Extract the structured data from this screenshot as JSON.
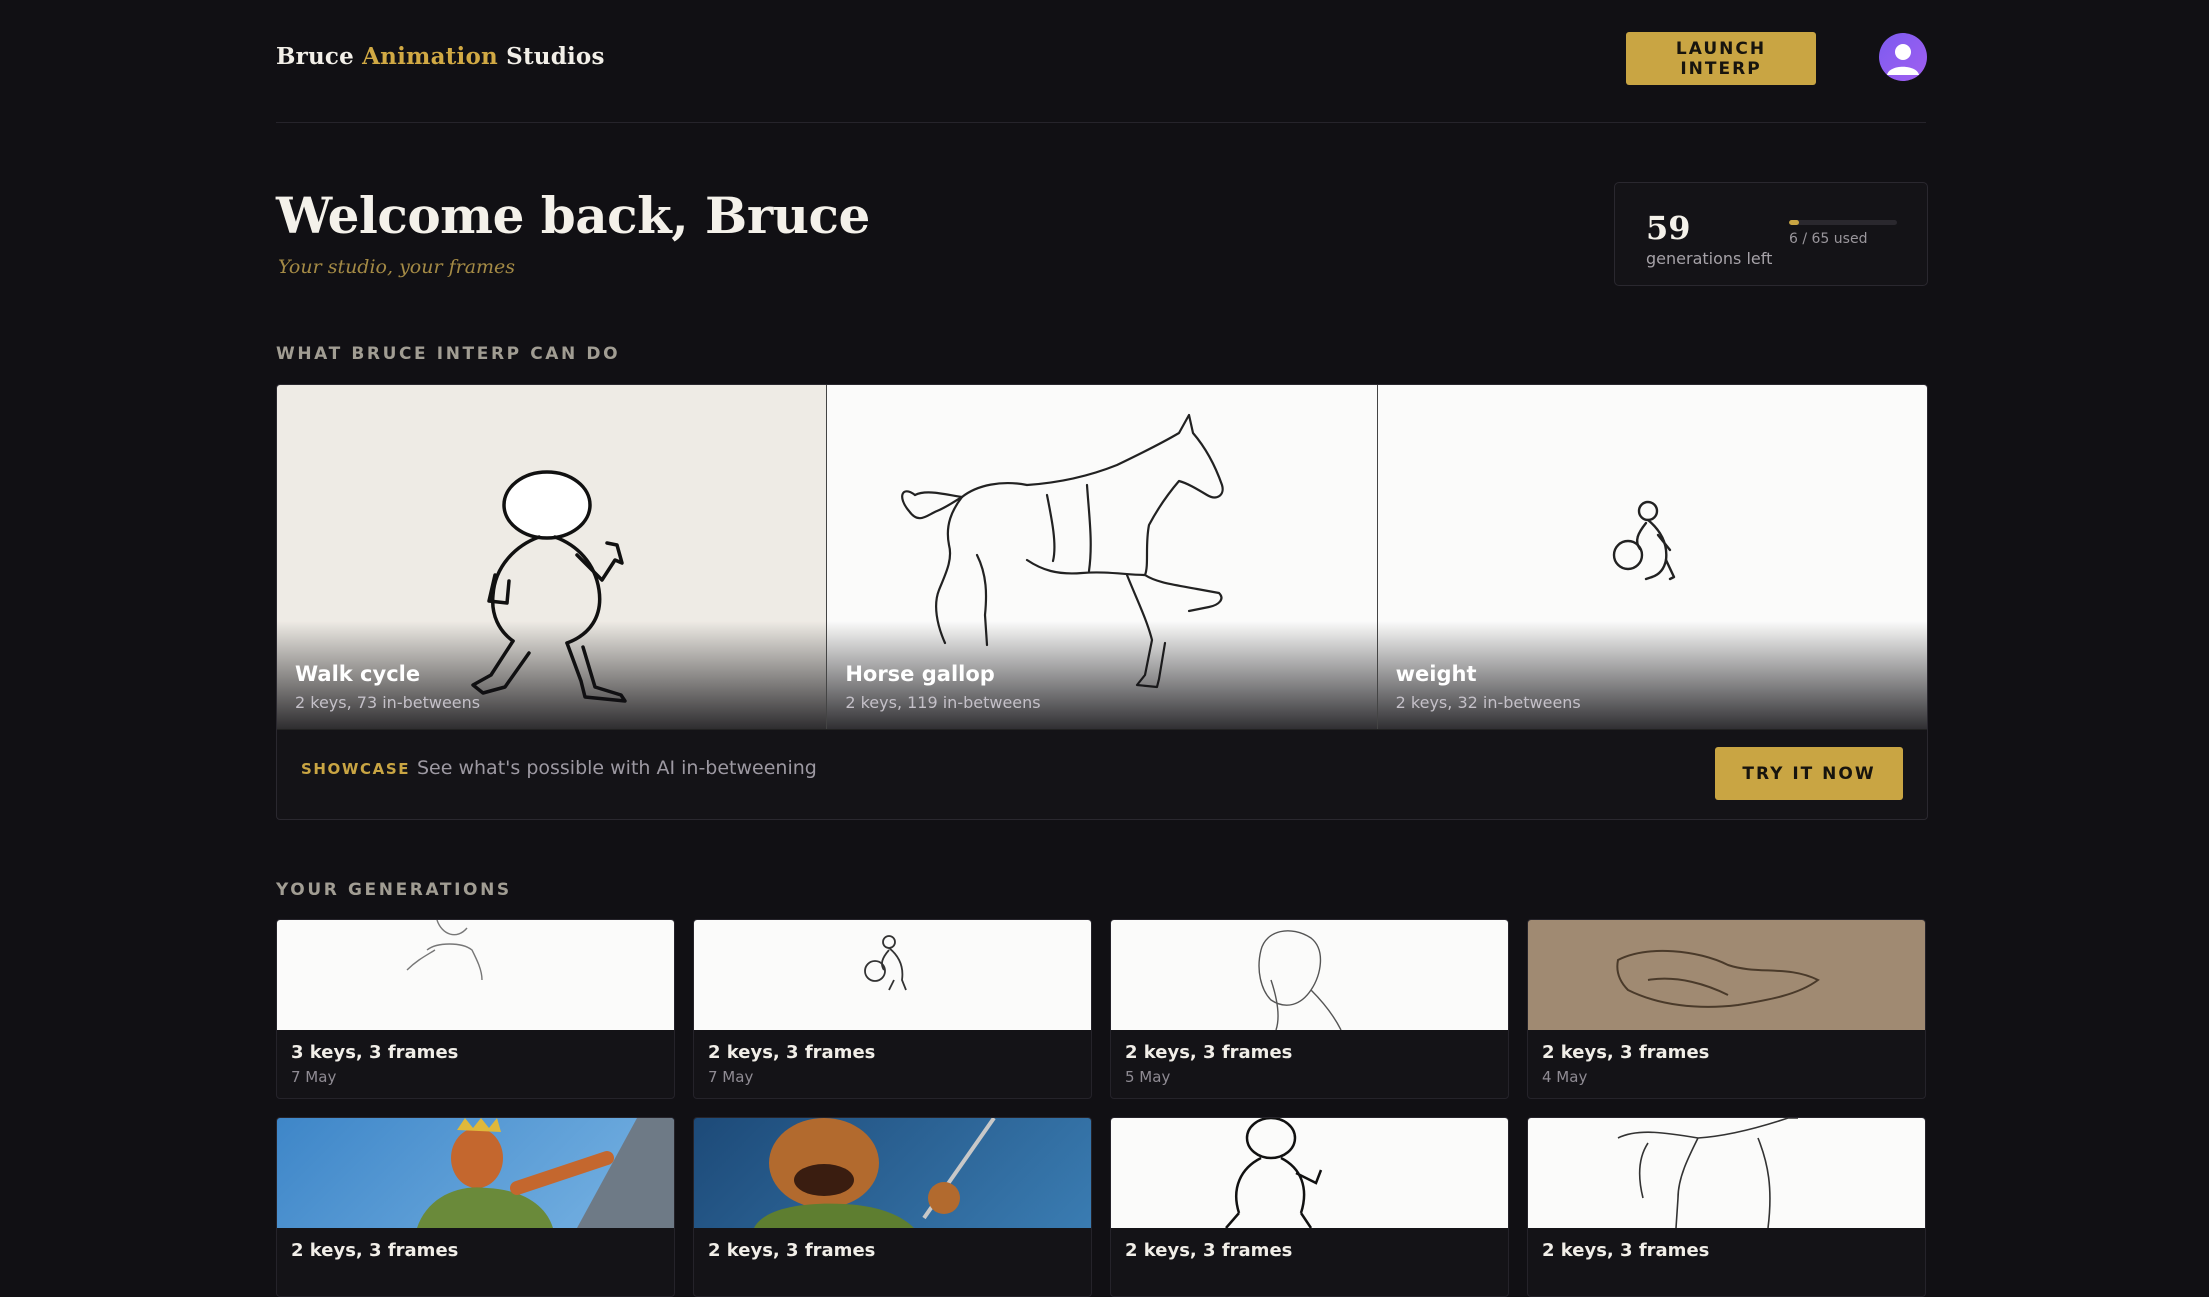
{
  "header": {
    "brand_part1": "Bruce",
    "brand_part2": "Animation",
    "brand_part3": "Studios",
    "launch_label": "LAUNCH INTERP",
    "avatar_icon": "user-avatar-icon"
  },
  "welcome": {
    "title": "Welcome back, Bruce",
    "tagline": "Your studio, your frames"
  },
  "credits": {
    "remaining": "59",
    "remaining_label": "generations left",
    "used_text": "6 / 65 used",
    "used_fraction": 0.092
  },
  "showcase": {
    "section_label": "WHAT BRUCE INTERP CAN DO",
    "tiles": [
      {
        "title": "Walk cycle",
        "subtitle": "2 keys, 73 in-betweens"
      },
      {
        "title": "Horse gallop",
        "subtitle": "2 keys, 119 in-betweens"
      },
      {
        "title": "weight",
        "subtitle": "2 keys, 32 in-betweens"
      }
    ],
    "tag": "SHOWCASE",
    "description": "See what's possible with AI in-betweening",
    "cta_label": "TRY IT NOW"
  },
  "generations": {
    "section_label": "YOUR GENERATIONS",
    "items": [
      {
        "title": "3 keys, 3 frames",
        "date": "7 May"
      },
      {
        "title": "2 keys, 3 frames",
        "date": "7 May"
      },
      {
        "title": "2 keys, 3 frames",
        "date": "5 May"
      },
      {
        "title": "2 keys, 3 frames",
        "date": "4 May"
      },
      {
        "title": "2 keys, 3 frames",
        "date": ""
      },
      {
        "title": "2 keys, 3 frames",
        "date": ""
      },
      {
        "title": "2 keys, 3 frames",
        "date": ""
      },
      {
        "title": "2 keys, 3 frames",
        "date": ""
      }
    ]
  },
  "colors": {
    "background": "#111014",
    "accent_gold": "#c9a543",
    "avatar_purple": "#7c5cf0"
  }
}
